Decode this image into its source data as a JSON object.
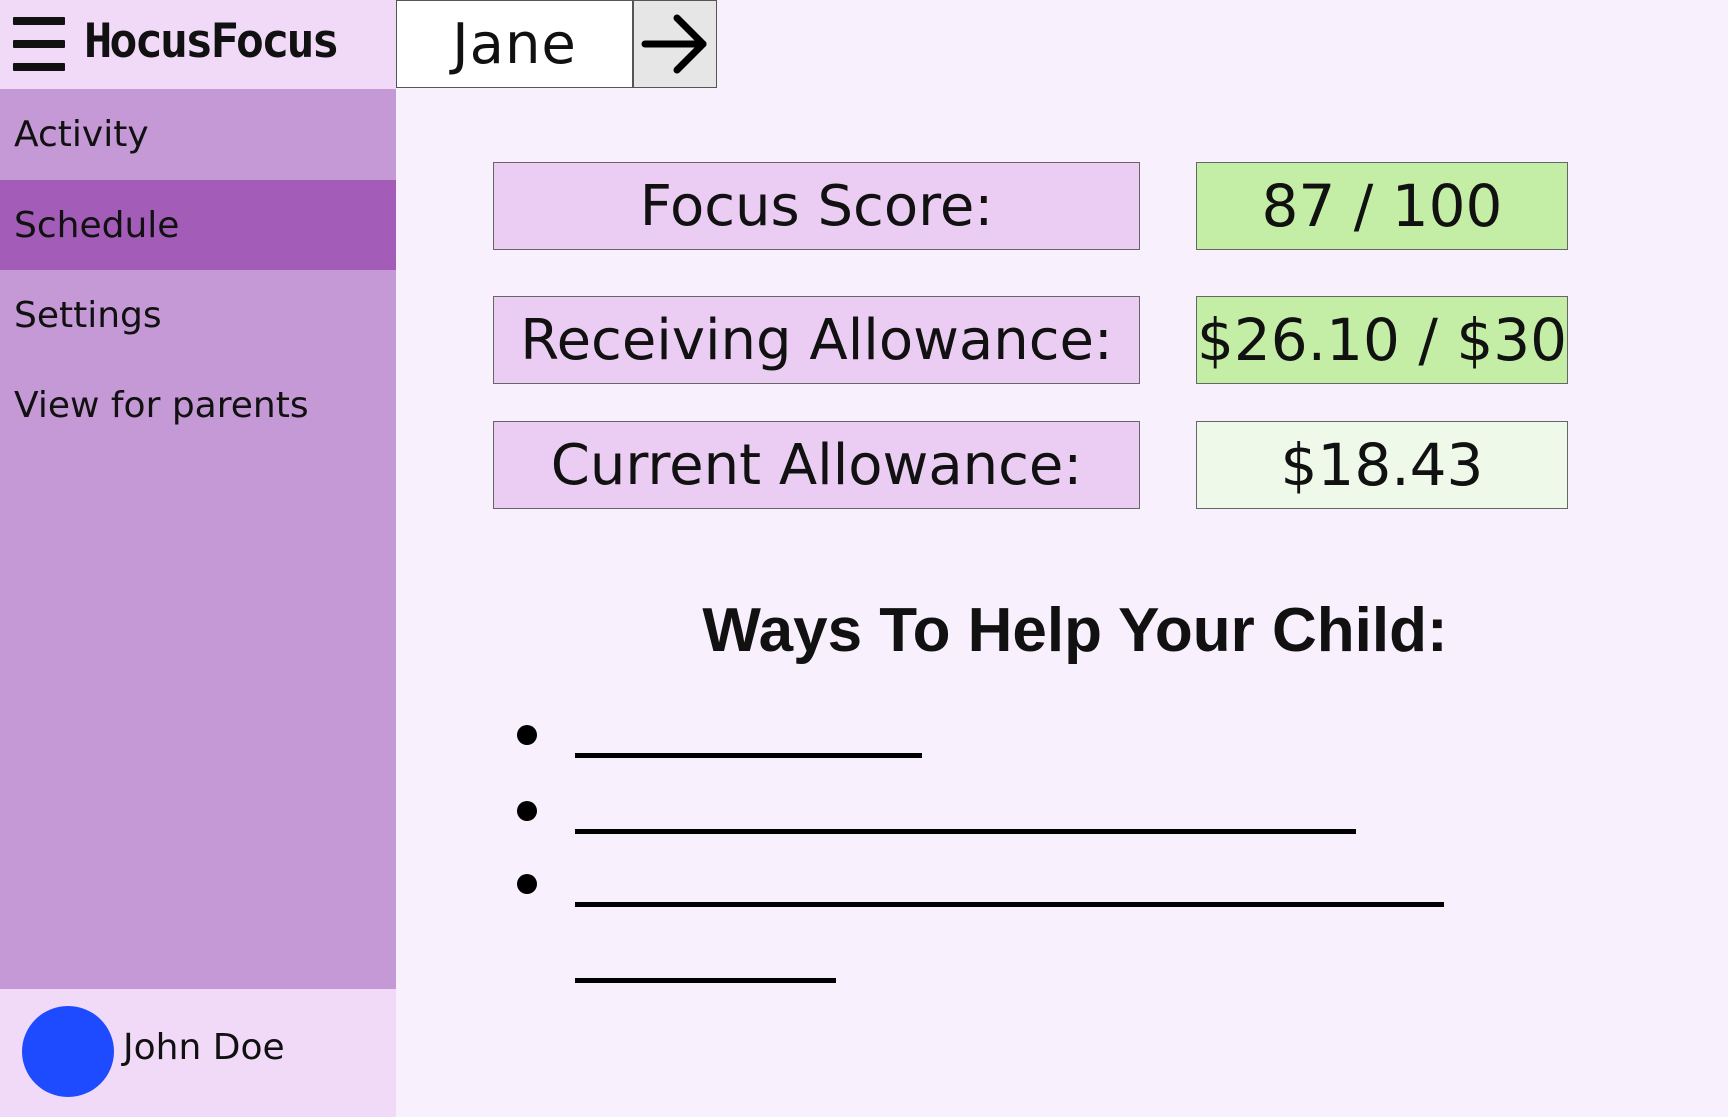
{
  "app": {
    "title": "HocusFocus"
  },
  "sidebar": {
    "items": [
      {
        "id": "activity",
        "label": "Activity",
        "active": false
      },
      {
        "id": "schedule",
        "label": "Schedule",
        "active": true
      },
      {
        "id": "settings",
        "label": "Settings",
        "active": false
      },
      {
        "id": "parents",
        "label": "View for parents",
        "active": false
      }
    ]
  },
  "user": {
    "name": "John Doe",
    "avatar_color": "#1e4bff"
  },
  "child_selector": {
    "value": "Jane",
    "button_icon": "arrow-right-icon"
  },
  "stats": {
    "focus_score": {
      "label": "Focus Score:",
      "value": "87 / 100"
    },
    "receiving_allowance": {
      "label": "Receiving Allowance:",
      "value": "$26.10 / $30"
    },
    "current_allowance": {
      "label": "Current Allowance:",
      "value": "$18.43"
    }
  },
  "tips": {
    "title": "Ways To Help Your Child:",
    "items": [
      "",
      "",
      ""
    ]
  },
  "colors": {
    "sidebar": "#c598d6",
    "sidebar_active": "#a35cb7",
    "header_panel": "#f1daf8",
    "background": "#f9f0fd",
    "label_fill": "#ebcdf3",
    "good_fill": "#c4eda5",
    "neutral_fill": "#eff9ea"
  }
}
